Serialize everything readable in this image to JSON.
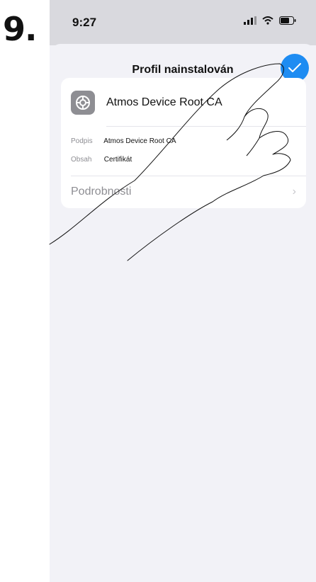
{
  "step": {
    "number": "9."
  },
  "status_bar": {
    "time": "9:27"
  },
  "sheet": {
    "title": "Profil nainstalován"
  },
  "profile": {
    "name": "Atmos Device Root CA",
    "signed_label": "Podpis",
    "signed_value": "Atmos Device Root CA",
    "contains_label": "Obsah",
    "contains_value": "Certifikát",
    "details_label": "Podrobnosti",
    "chevron": "›"
  },
  "colors": {
    "accent": "#1e8cf2",
    "background": "#f2f2f7"
  },
  "icons": {
    "done": "checkmark-icon",
    "profile": "settings-gear-icon",
    "hand": "pointing-hand-illustration"
  }
}
